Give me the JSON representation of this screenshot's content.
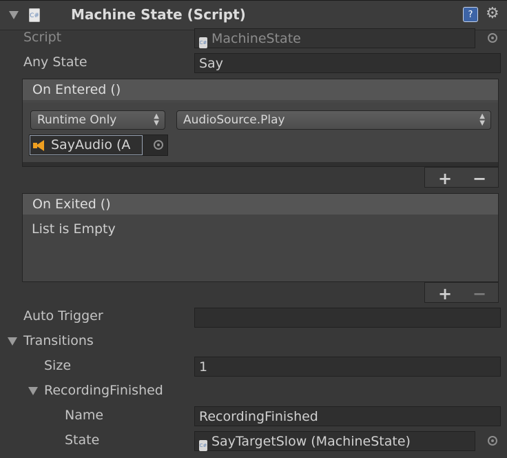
{
  "component": {
    "title": "Machine State (Script)"
  },
  "fields": {
    "script_label": "Script",
    "script_value": "MachineState",
    "any_state_label": "Any State",
    "any_state_value": "Say"
  },
  "on_entered": {
    "header": "On Entered ()",
    "runtime_option": "Runtime Only",
    "function": "AudioSource.Play",
    "object": "SayAudio (A"
  },
  "on_exited": {
    "header": "On Exited ()",
    "empty_text": "List is Empty"
  },
  "buttons": {
    "plus": "+",
    "minus": "−"
  },
  "auto_trigger": {
    "label": "Auto Trigger",
    "value": ""
  },
  "transitions": {
    "label": "Transitions",
    "size_label": "Size",
    "size_value": "1",
    "element_label": "RecordingFinished",
    "name_label": "Name",
    "name_value": "RecordingFinished",
    "state_label": "State",
    "state_value": "SayTargetSlow (MachineState)"
  },
  "icons": {
    "foldout": "triangle-down-icon",
    "script": "csharp-script-icon",
    "help": "help-book-icon",
    "settings": "gear-icon",
    "object_picker": "object-picker-icon",
    "audio": "speaker-icon"
  },
  "colors": {
    "background": "#383838",
    "header_bar": "#555555",
    "field": "#2f2f2f",
    "audio_icon": "#f0a020"
  }
}
